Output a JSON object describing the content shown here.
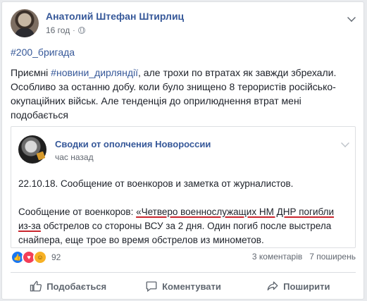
{
  "post": {
    "author": "Анатолий Штефан Штирлиц",
    "time": "16 год",
    "hashtag": "#200_бригада",
    "text_prefix": "Приємні ",
    "text_tag": "#новини_дирляндії",
    "text_suffix": ", але трохи по втратах як завжди збрехали. Особливо за останню добу. коли було знищено 8 терористів російсько-окупаційних військ. Але тенденція до оприлюднення втрат мені подобається"
  },
  "shared": {
    "author": "Сводки от ополчения Новороссии",
    "time": "час назад",
    "line1": "22.10.18. Сообщение от военкоров и заметка от журналистов.",
    "line2_prefix": "Сообщение от военкоров: ",
    "line2_underlined": "«Четверо военнослужащих НМ ДНР погибли из-за",
    "line2_rest": " обстрелов со стороны ВСУ за 2 дня. Один погиб после выстрела снайпера, еще трое во время обстрелов из минометов."
  },
  "stats": {
    "reactions_count": "92",
    "comments": "3 коментарів",
    "shares": "7 поширень"
  },
  "actions": {
    "like": "Подобається",
    "comment": "Коментувати",
    "share": "Поширити"
  },
  "colors": {
    "link": "#365899",
    "underline": "#c9252d",
    "like": "#1877f2",
    "love": "#f33e58",
    "haha": "#f7b125"
  },
  "icons": [
    "globe-icon",
    "chevron-down-icon",
    "like-reaction-icon",
    "love-reaction-icon",
    "haha-reaction-icon",
    "thumbs-up-icon",
    "comment-icon",
    "share-icon"
  ]
}
